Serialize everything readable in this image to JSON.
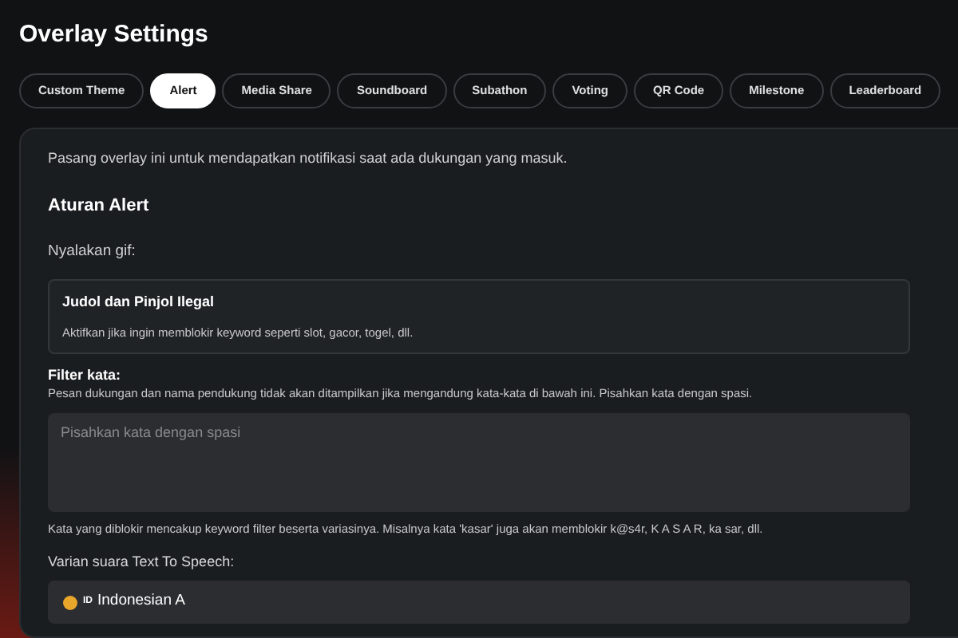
{
  "page": {
    "title": "Overlay Settings"
  },
  "tabs": [
    {
      "label": "Custom Theme",
      "selected": false
    },
    {
      "label": "Alert",
      "selected": true
    },
    {
      "label": "Media Share",
      "selected": false
    },
    {
      "label": "Soundboard",
      "selected": false
    },
    {
      "label": "Subathon",
      "selected": false
    },
    {
      "label": "Voting",
      "selected": false
    },
    {
      "label": "QR Code",
      "selected": false
    },
    {
      "label": "Milestone",
      "selected": false
    },
    {
      "label": "Leaderboard",
      "selected": false
    }
  ],
  "panel": {
    "intro": "Pasang overlay ini untuk mendapatkan notifikasi saat ada dukungan yang masuk.",
    "heading": "Aturan Alert",
    "gif_label": "Nyalakan gif:",
    "block_card": {
      "title": "Judol dan Pinjol Ilegal",
      "description": "Aktifkan jika ingin memblokir keyword seperti slot, gacor, togel, dll."
    },
    "filter": {
      "label": "Filter kata:",
      "help": "Pesan dukungan dan nama pendukung tidak akan ditampilkan jika mengandung kata-kata di bawah ini. Pisahkan kata dengan spasi.",
      "placeholder": "Pisahkan kata dengan spasi",
      "note": "Kata yang diblokir mencakup keyword filter beserta variasinya. Misalnya kata 'kasar' juga akan memblokir k@s4r, K A S A R, ka sar, dll."
    },
    "tts": {
      "label": "Varian suara Text To Speech:",
      "flag": "ID",
      "value": "Indonesian A"
    }
  }
}
